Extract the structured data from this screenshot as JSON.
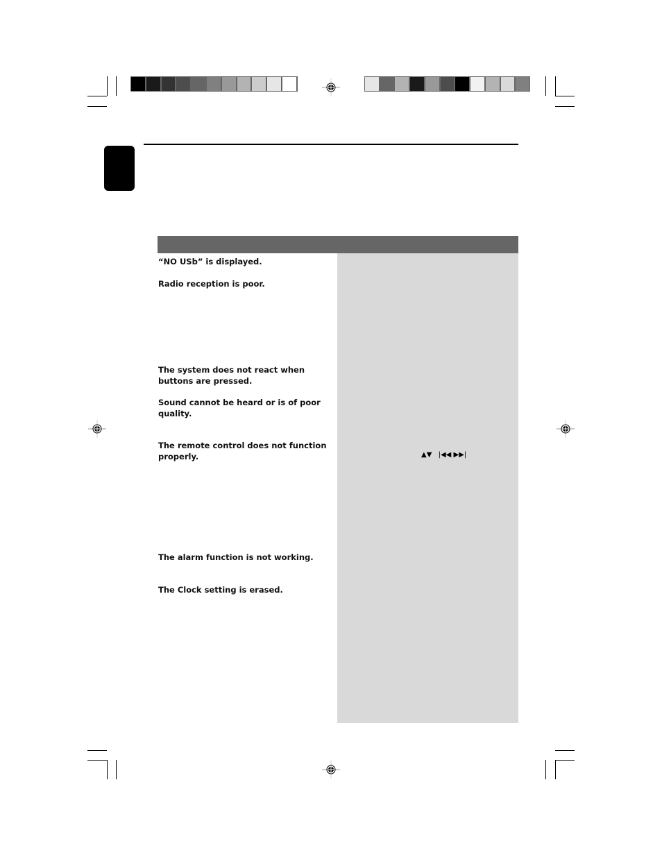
{
  "page": {
    "colors": {
      "header_bar": "#666666",
      "solution_column": "#d9d9d9",
      "language_tab": "#000000"
    },
    "color_bar_left": [
      "#000000",
      "#1a1a1a",
      "#333333",
      "#4d4d4d",
      "#666666",
      "#808080",
      "#999999",
      "#b3b3b3",
      "#cccccc",
      "#e6e6e6",
      "#ffffff"
    ],
    "color_bar_right": [
      "#e6e6e6",
      "#666666",
      "#b3b3b3",
      "#1a1a1a",
      "#999999",
      "#4d4d4d",
      "#000000",
      "#f2f2f2",
      "#b3b3b3",
      "#d9d9d9",
      "#808080"
    ]
  },
  "troubleshooting": {
    "problems": [
      {
        "text": "“NO USb” is displayed."
      },
      {
        "text": "Radio reception is poor."
      },
      {
        "text": "The system does not react when buttons are pressed."
      },
      {
        "text": "Sound cannot be heard or is of poor quality."
      },
      {
        "text": "The remote control does not function properly."
      },
      {
        "text": "The alarm function is not working."
      },
      {
        "text": "The Clock setting is erased."
      }
    ],
    "remote_buttons_glyphs": "▲▼ ⏮◀◀ ▶▶⏭",
    "remote_buttons": {
      "up_down": "▲▼",
      "prev_next": "|◀◀ ▶▶|"
    }
  }
}
